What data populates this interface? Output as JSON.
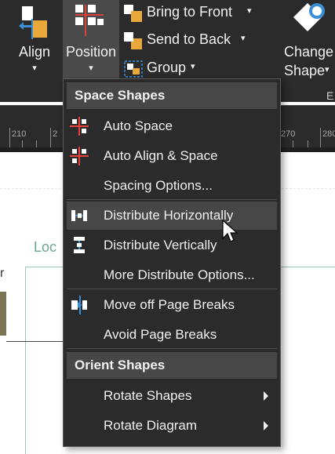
{
  "ribbon": {
    "align_label": "Align",
    "position_label": "Position",
    "bring_to_front_label": "Bring to Front",
    "send_to_back_label": "Send to Back",
    "group_label": "Group",
    "change_shape_label_1": "Change",
    "change_shape_label_2": "Shape",
    "cut_off_group_label": "E",
    "dropdown_glyph": "▾"
  },
  "ruler": {
    "labels": [
      "210",
      "2",
      "270",
      "280"
    ]
  },
  "canvas": {
    "loc_text": "Loc",
    "r_text": "r"
  },
  "menu": {
    "sections": [
      {
        "header": "Space Shapes",
        "items": [
          {
            "label": "Auto Space",
            "icon": "auto-space-icon",
            "shortcut_letter": "S"
          },
          {
            "label": "Auto Align & Space",
            "icon": "auto-align-space-icon",
            "shortcut_letter": "A"
          },
          {
            "label": "Spacing Options...",
            "icon": "",
            "shortcut_letter": "O"
          }
        ],
        "items_group2": [
          {
            "label": "Distribute Horizontally",
            "icon": "distribute-horizontally-icon",
            "shortcut_letter": "H",
            "hovered": true
          },
          {
            "label": "Distribute Vertically",
            "icon": "distribute-vertically-icon",
            "shortcut_letter": "V"
          },
          {
            "label": "More Distribute Options...",
            "icon": "",
            "shortcut_letter": "M"
          }
        ],
        "items_group3": [
          {
            "label": "Move off Page Breaks",
            "icon": "move-off-page-breaks-icon",
            "shortcut_letter": "P"
          },
          {
            "label": "Avoid Page Breaks",
            "icon": "",
            "shortcut_letter": "A"
          }
        ]
      },
      {
        "header": "Orient Shapes",
        "items": [
          {
            "label": "Rotate Shapes",
            "icon": "",
            "shortcut_letter": "t",
            "submenu": true
          },
          {
            "label": "Rotate Diagram",
            "icon": "",
            "shortcut_letter": "D",
            "submenu": true
          }
        ]
      }
    ]
  },
  "colors": {
    "ribbon_bg": "#2b2b2b",
    "menu_bg": "#2b2b2b",
    "menu_header_bg": "#474747",
    "hover_bg": "#474747",
    "text": "#f0f0f0",
    "accent_red": "#e8413c",
    "accent_blue": "#3b8fd6",
    "accent_gold": "#e8a93a",
    "canvas_green": "#6aa58f"
  }
}
